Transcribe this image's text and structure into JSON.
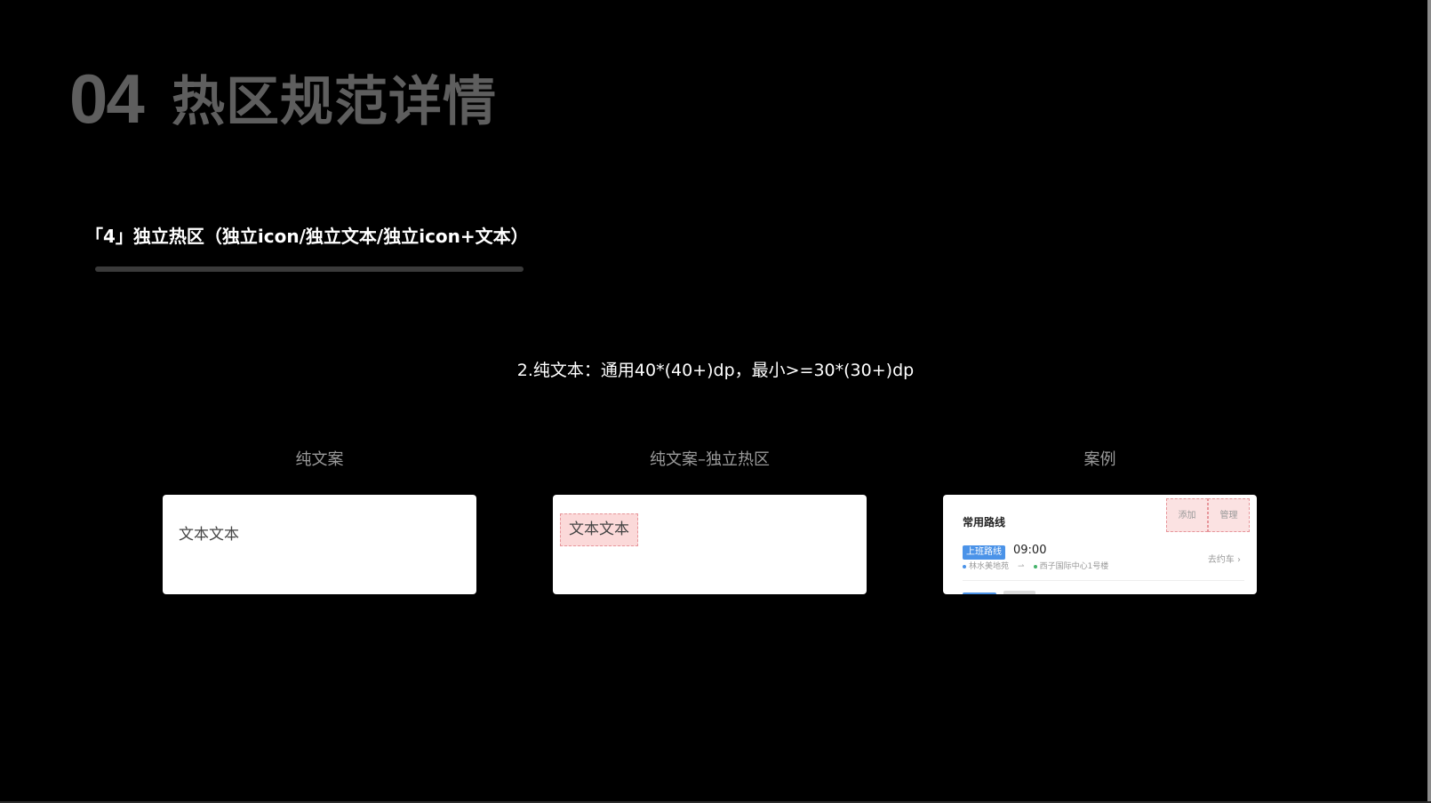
{
  "header": {
    "number": "04",
    "title": "热区规范详情"
  },
  "section": {
    "title": "「4」独立热区（独立icon/独立文本/独立icon+文本）"
  },
  "subtitle": "2.纯文本：通用40*(40+)dp，最小>=30*(30+)dp",
  "columns": [
    {
      "label": "纯文案",
      "sample_text": "文本文本"
    },
    {
      "label": "纯文案–独立热区",
      "sample_text": "文本文本"
    },
    {
      "label": "案例"
    }
  ],
  "example": {
    "title": "常用路线",
    "add_label": "添加",
    "manage_label": "管理",
    "tag": "上班路线",
    "time": "09:00",
    "from": "林水美地苑",
    "to": "西子国际中心1号楼",
    "action": "去约车 ›"
  },
  "colors": {
    "background": "#000000",
    "title_gray": "#5e5e5e",
    "hot_zone_fill": "#fbd9d9",
    "hot_zone_border": "#e7959a",
    "tag_blue": "#4b93e8"
  }
}
